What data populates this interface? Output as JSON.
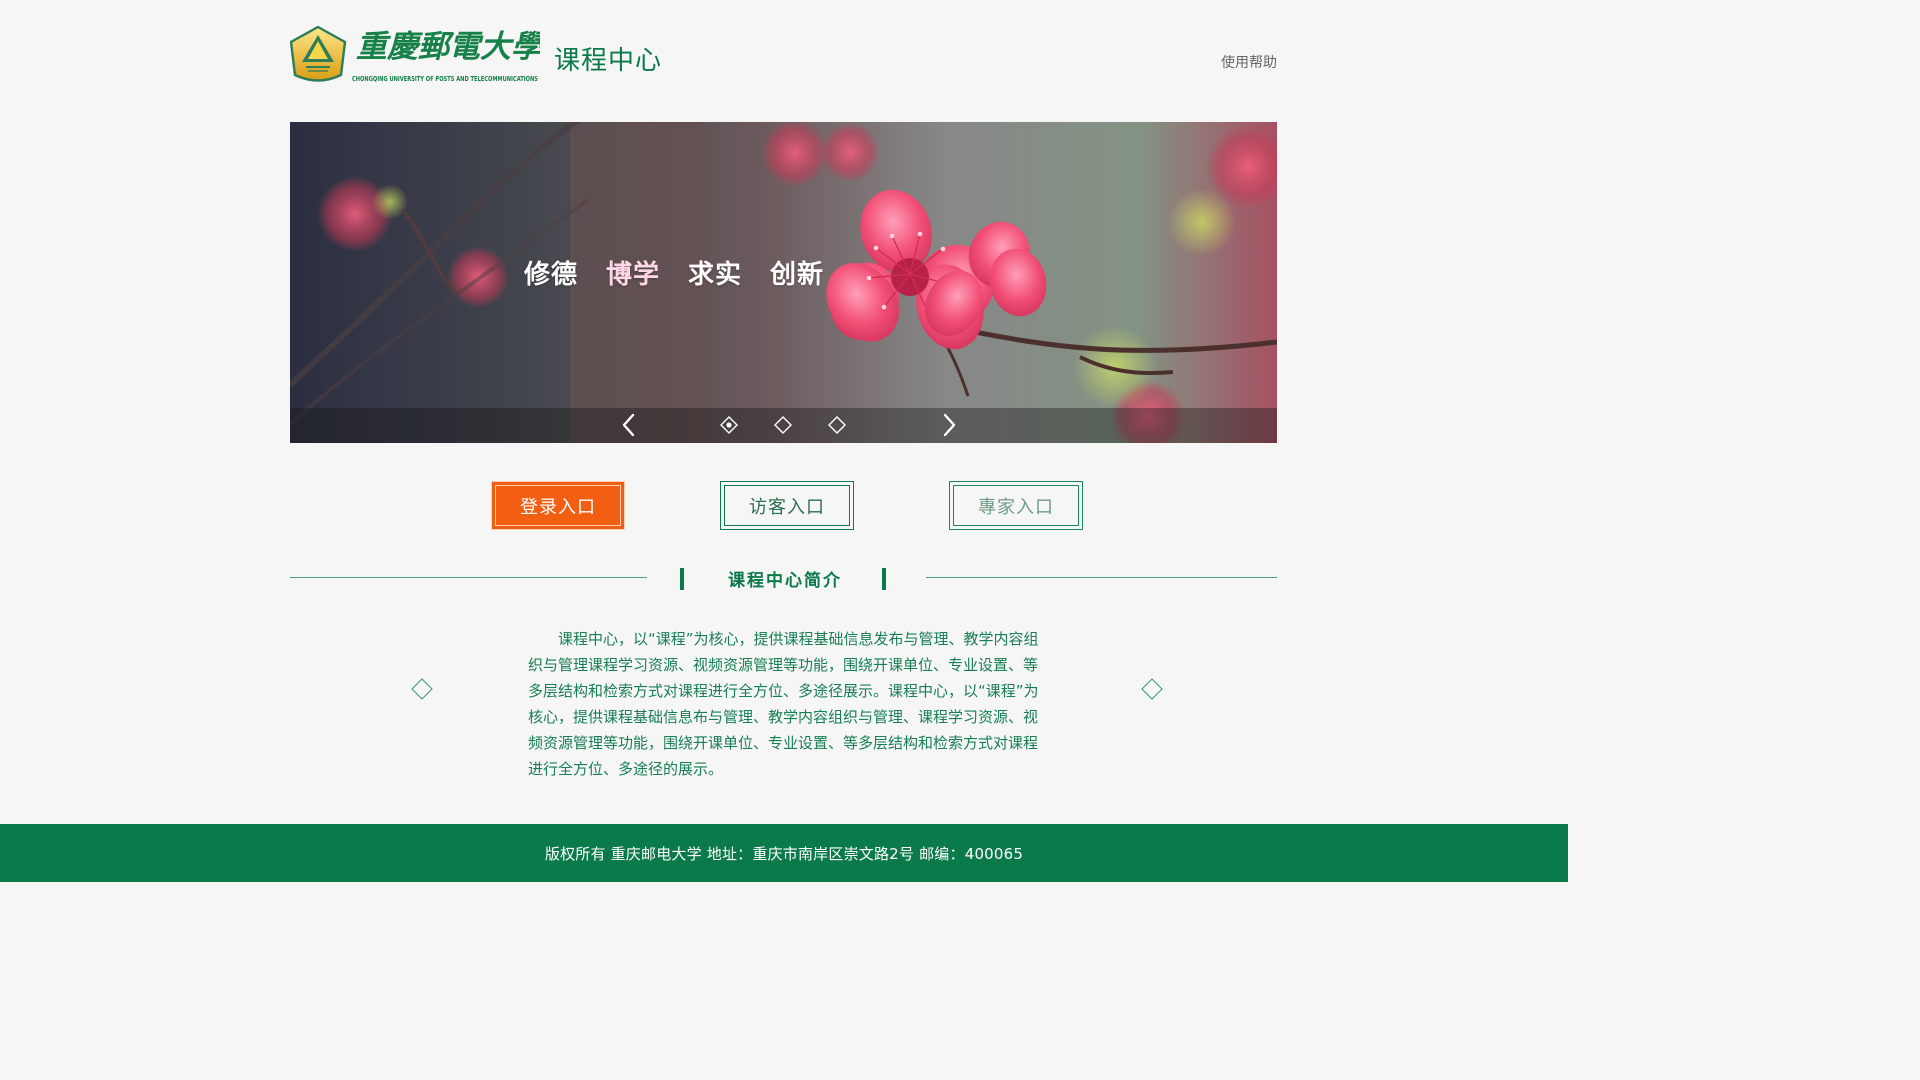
{
  "header": {
    "logo": {
      "chinese_name": "重慶郵電大學",
      "english_name": "CHONGQING UNIVERSITY OF POSTS AND TELECOMMUNICATIONS"
    },
    "title": "课程中心",
    "help_label": "使用帮助"
  },
  "banner": {
    "motto_1": "修德",
    "motto_2": "博学",
    "motto_3": "求实",
    "motto_4": "创新",
    "active_slide": 1,
    "slides_count": 3,
    "left_arrow_icon": "chevron-left-icon",
    "right_arrow_icon": "chevron-right-icon"
  },
  "entries": {
    "login": "登录入口",
    "visitor": "访客入口",
    "expert": "專家入口"
  },
  "section": {
    "title": "课程中心简介",
    "intro": "课程中心，以“课程”为核心，提供课程基础信息发布与管理、教学内容组织与管理课程学习资源、视频资源管理等功能，围绕开课单位、专业设置、等多层结构和检索方式对课程进行全方位、多途径展示。课程中心，以“课程”为核心，提供课程基础信息布与管理、教学内容组织与管理、课程学习资源、视频资源管理等功能，围绕开课单位、专业设置、等多层结构和检索方式对课程进行全方位、多途径的展示。"
  },
  "footer": {
    "text": "版权所有 重庆邮电大学 地址：重庆市南岸区崇文路2号 邮编：400065"
  },
  "colors": {
    "primary_green": "#0b7a4a",
    "accent_orange": "#f25f12",
    "background": "#f6f6f6"
  }
}
